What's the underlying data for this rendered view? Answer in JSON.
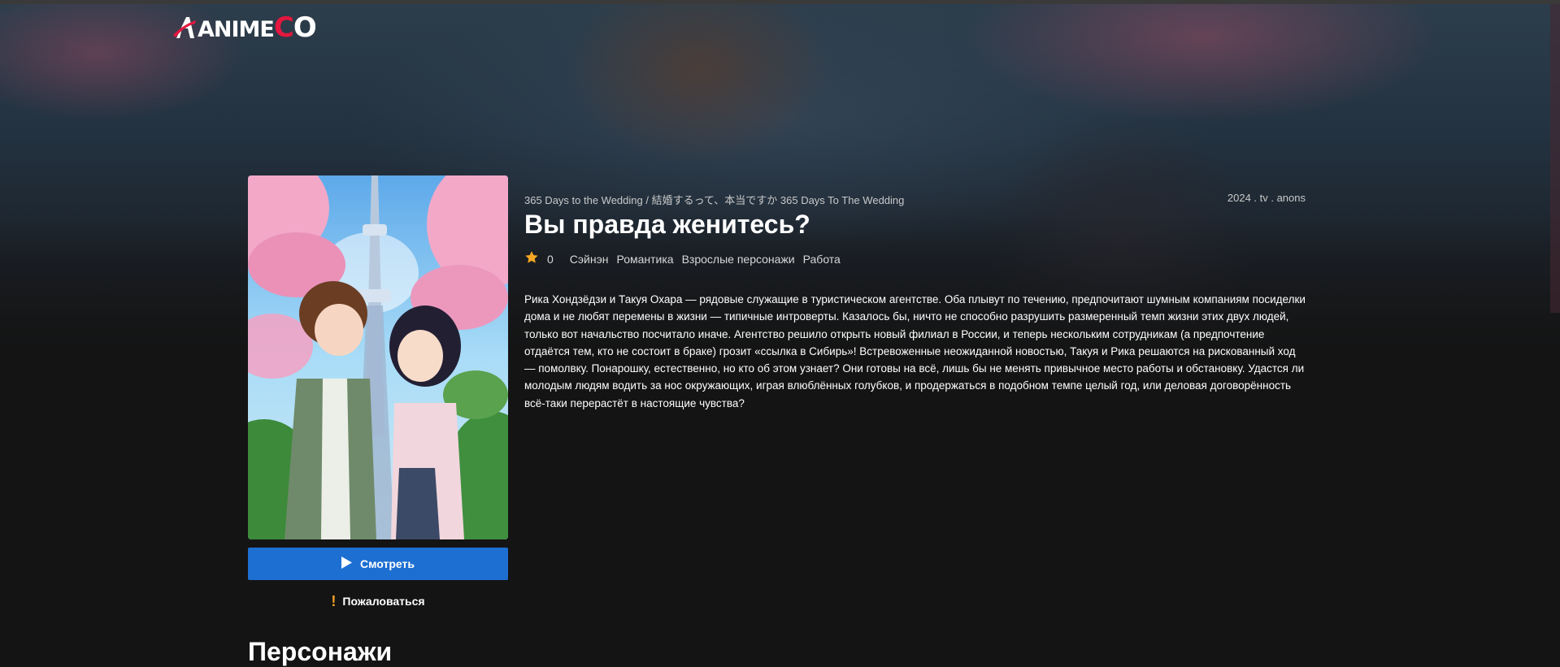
{
  "logo": {
    "part1": "ANIME",
    "part2": "C",
    "part3": "O"
  },
  "anime": {
    "alt_names": "365 Days to the Wedding / 結婚するって、本当ですか 365 Days To The Wedding",
    "year_type": "2024 . tv . anons",
    "title": "Вы правда женитесь?",
    "rating": "0",
    "genres": [
      "Сэйнэн",
      "Романтика",
      "Взрослые персонажи",
      "Работа"
    ],
    "description": "Рика Хондзёдзи и Такуя Охара — рядовые служащие в туристическом агентстве. Оба плывут по течению, предпочитают шумным компаниям посиделки дома и не любят перемены в жизни — типичные интроверты. Казалось бы, ничто не способно разрушить размеренный темп жизни этих двух людей, только вот начальство посчитало иначе. Агентство решило открыть новый филиал в России, и теперь нескольким сотрудникам (а предпочтение отдаётся тем, кто не состоит в браке) грозит «ссылка в Сибирь»! Встревоженные неожиданной новостью, Такуя и Рика решаются на рискованный ход — помолвку. Понарошку, естественно, но кто об этом узнает? Они готовы на всё, лишь бы не менять привычное место работы и обстановку. Удастся ли молодым людям водить за нос окружающих, играя влюблённых голубков, и продержаться в подобном темпе целый год, или деловая договорённость всё-таки перерастёт в настоящие чувства?"
  },
  "actions": {
    "watch_label": "Смотреть",
    "report_label": "Пожаловаться",
    "report_icon": "!"
  },
  "sections": {
    "characters_title": "Персонажи"
  },
  "colors": {
    "accent": "#1e6fd2",
    "brand_red": "#e3173f",
    "star": "#f5a623",
    "background": "#141414"
  },
  "icons": {
    "rating": "star-icon",
    "watch": "play-icon",
    "report": "exclamation-icon"
  }
}
